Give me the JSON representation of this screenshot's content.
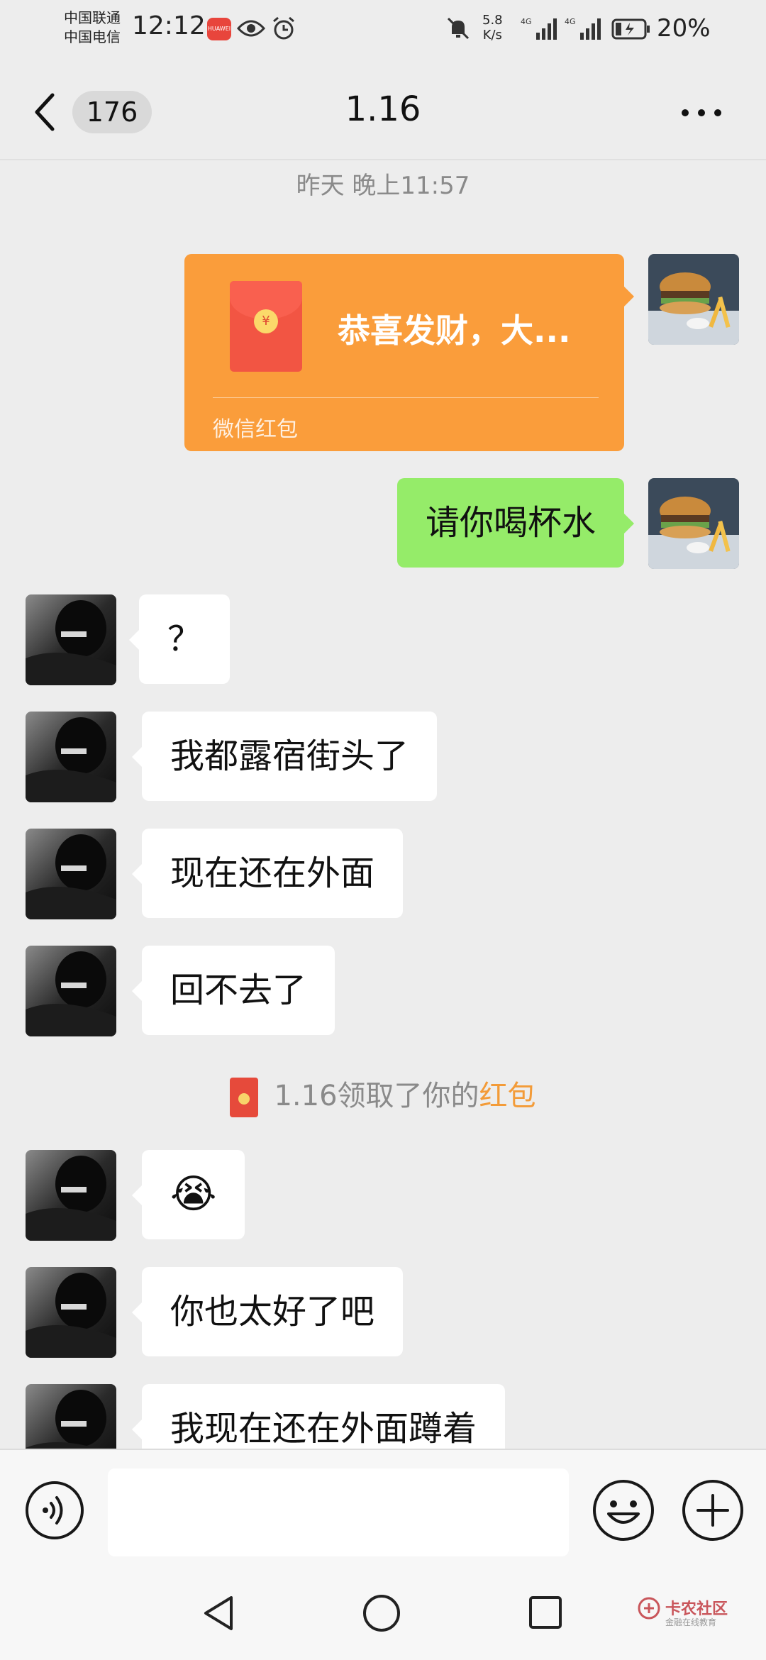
{
  "status_bar": {
    "carrier_1": "中国联通",
    "carrier_2": "中国电信",
    "time": "12:12",
    "net_speed_value": "5.8",
    "net_speed_unit": "K/s",
    "signal_1_label": "4G",
    "signal_2_label": "4G",
    "battery": "20%",
    "icons": [
      "app-badge-icon",
      "eye-icon",
      "alarm-icon",
      "mute-icon",
      "signal-icon",
      "battery-charging-icon"
    ]
  },
  "header": {
    "unread_count": "176",
    "title": "1.16",
    "icons": [
      "back-chevron-icon",
      "more-icon"
    ]
  },
  "timestamp": "昨天 晚上11:57",
  "red_packet": {
    "text": "恭喜发财，大...",
    "label": "微信红包",
    "color": "#fa9d3b"
  },
  "messages": [
    {
      "side": "right",
      "text": "请你喝杯水"
    },
    {
      "side": "left",
      "text": "？"
    },
    {
      "side": "left",
      "text": "我都露宿街头了"
    },
    {
      "side": "left",
      "text": "现在还在外面"
    },
    {
      "side": "left",
      "text": "回不去了"
    },
    {
      "side": "left",
      "text": "😭"
    },
    {
      "side": "left",
      "text": "你也太好了吧"
    },
    {
      "side": "left",
      "text": "我现在还在外面蹲着"
    }
  ],
  "system_message": {
    "prefix": "1.16领取了你的",
    "link": "红包"
  },
  "input_bar": {
    "value": "",
    "icons": [
      "voice-icon",
      "emoji-icon",
      "plus-icon"
    ]
  },
  "nav": {
    "icons": [
      "nav-back-icon",
      "nav-home-icon",
      "nav-recent-icon"
    ]
  },
  "watermark": {
    "main": "卡农社区",
    "sub": "金融在线教育"
  },
  "colors": {
    "chat_bg": "#ededed",
    "my_bubble": "#95ec69",
    "their_bubble": "#ffffff",
    "link_orange": "#f39b38"
  }
}
